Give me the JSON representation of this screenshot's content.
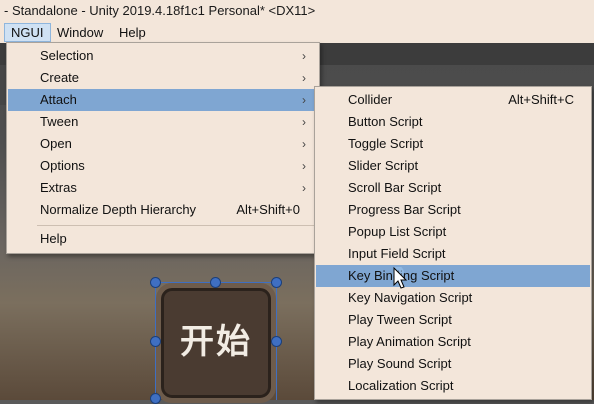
{
  "window": {
    "title": "- Standalone - Unity 2019.4.18f1c1 Personal* <DX11>"
  },
  "menubar": {
    "items": [
      "NGUI",
      "Window",
      "Help"
    ]
  },
  "scene": {
    "button_text": "开始"
  },
  "ngui_menu": {
    "items": [
      {
        "label": "Selection",
        "submenu": true
      },
      {
        "label": "Create",
        "submenu": true
      },
      {
        "label": "Attach",
        "submenu": true,
        "highlighted": true
      },
      {
        "label": "Tween",
        "submenu": true
      },
      {
        "label": "Open",
        "submenu": true
      },
      {
        "label": "Options",
        "submenu": true
      },
      {
        "label": "Extras",
        "submenu": true
      },
      {
        "label": "Normalize Depth Hierarchy",
        "shortcut": "Alt+Shift+0"
      },
      {
        "label": "Help"
      }
    ]
  },
  "attach_menu": {
    "items": [
      {
        "label": "Collider",
        "shortcut": "Alt+Shift+C"
      },
      {
        "label": "Button Script"
      },
      {
        "label": "Toggle Script"
      },
      {
        "label": "Slider Script"
      },
      {
        "label": "Scroll Bar Script"
      },
      {
        "label": "Progress Bar Script"
      },
      {
        "label": "Popup List Script"
      },
      {
        "label": "Input Field Script"
      },
      {
        "label": "Key Binding Script",
        "highlighted": true
      },
      {
        "label": "Key Navigation Script"
      },
      {
        "label": "Play Tween Script"
      },
      {
        "label": "Play Animation Script"
      },
      {
        "label": "Play Sound Script"
      },
      {
        "label": "Localization Script"
      }
    ]
  },
  "icons": {
    "submenu_arrow": "chevron-right-icon",
    "cursor": "mouse-pointer-icon"
  },
  "colors": {
    "menu_bg": "#f3e6da",
    "highlight": "#7fa6d2",
    "gizmo": "#3f6fc2"
  }
}
